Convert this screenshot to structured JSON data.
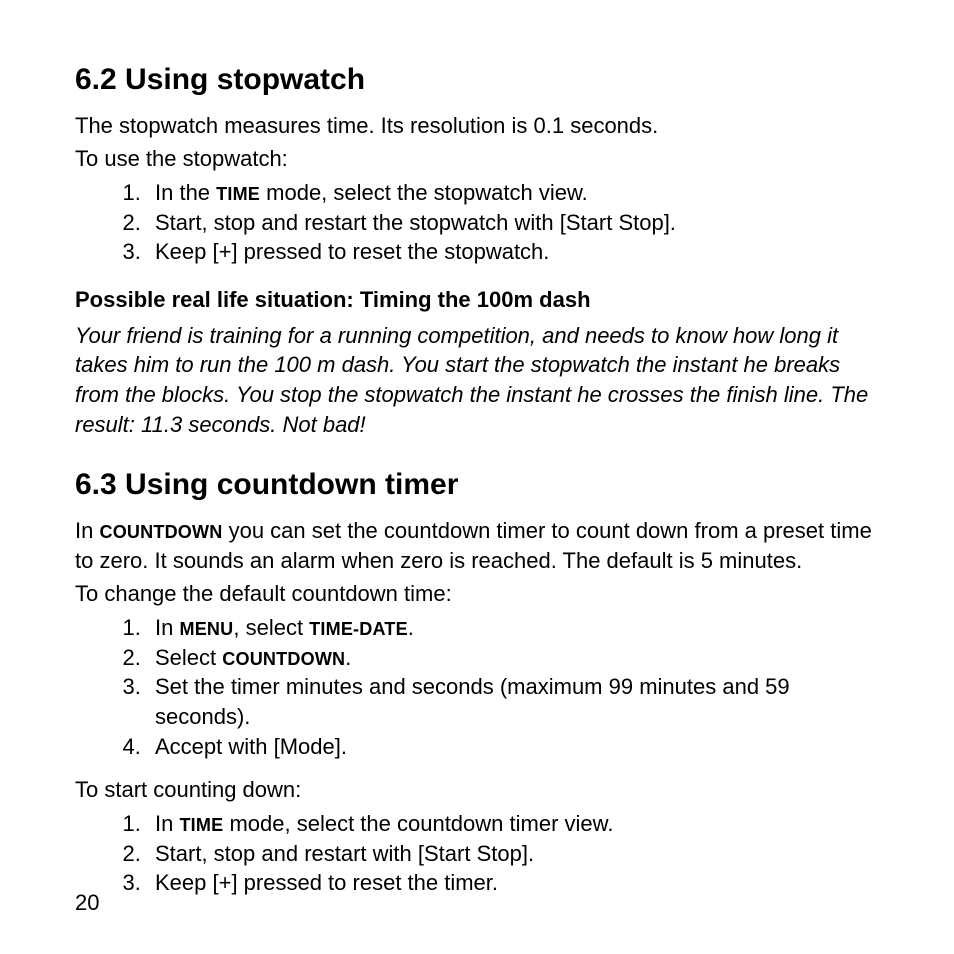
{
  "section62": {
    "heading": "6.2  Using stopwatch",
    "intro": "The stopwatch measures time. Its resolution is 0.1 seconds.",
    "lead": "To use the stopwatch:",
    "step1_pre": "In the ",
    "step1_sc": "TIME",
    "step1_post": " mode, select the stopwatch view.",
    "step2": "Start, stop and restart the stopwatch with [Start Stop].",
    "step3": "Keep [+] pressed to reset the stopwatch."
  },
  "scenario": {
    "title": "Possible real life situation: Timing the 100m dash",
    "body": "Your friend is training for a running competition, and needs to know how long it takes him to run the 100 m dash. You start the stopwatch the instant he breaks from the blocks. You stop the stopwatch the instant he crosses the finish line. The result: 11.3 seconds. Not bad!"
  },
  "section63": {
    "heading": "6.3  Using countdown timer",
    "intro_pre": "In ",
    "intro_sc": "COUNTDOWN",
    "intro_post": " you can set the countdown timer to count down from a preset time to zero. It sounds an alarm when zero is reached. The default is 5 minutes.",
    "lead1": "To change the default countdown time:",
    "s1_pre": "In ",
    "s1_sc1": "MENU",
    "s1_mid": ", select ",
    "s1_sc2": "TIME-DATE",
    "s1_post": ".",
    "s2_pre": "Select ",
    "s2_sc": "COUNTDOWN",
    "s2_post": ".",
    "s3": "Set the timer minutes and seconds (maximum 99 minutes and 59 seconds).",
    "s4": "Accept with [Mode].",
    "lead2": "To start counting down:",
    "t1_pre": "In ",
    "t1_sc": "TIME",
    "t1_post": " mode, select the countdown timer view.",
    "t2": "Start, stop and restart with [Start Stop].",
    "t3": "Keep [+] pressed to reset the timer."
  },
  "pageNumber": "20"
}
